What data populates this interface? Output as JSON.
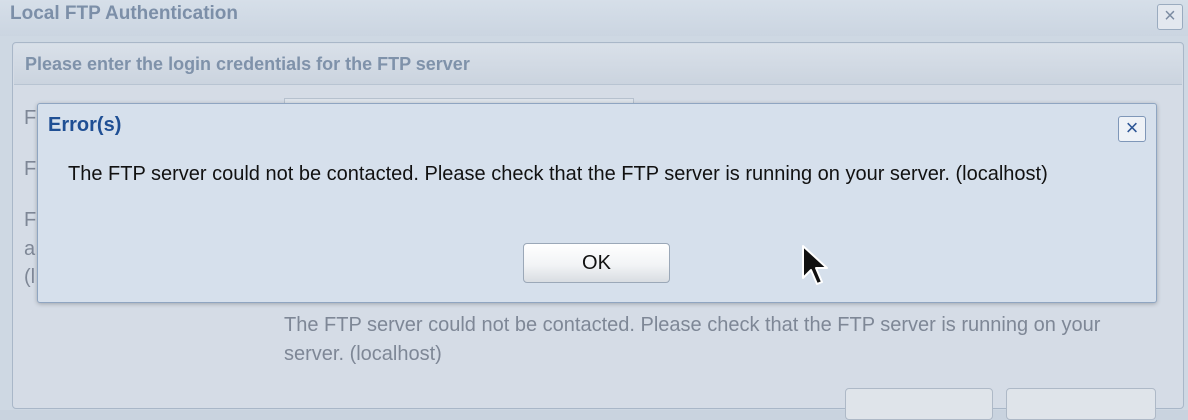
{
  "background_dialog": {
    "title": "Local FTP Authentication",
    "close_glyph": "×",
    "panel_title": "Please enter the login credentials for the FTP server",
    "partial_labels": [
      "F",
      "F",
      "F",
      "a",
      "(l"
    ],
    "error_message": "The FTP server could not be contacted. Please check that the FTP server is running on your server. (localhost)"
  },
  "error_dialog": {
    "title": "Error(s)",
    "close_glyph": "×",
    "message": "The FTP server could not be contacted. Please check that the FTP server is running on your server. (localhost)",
    "ok_label": "OK"
  },
  "icons": {
    "close": "close-icon",
    "pointer": "mouse-pointer-icon"
  },
  "colors": {
    "error_title": "#1f4f94",
    "dialog_background": "#d6e0ec",
    "dimmed_background": "#ced8e3"
  }
}
